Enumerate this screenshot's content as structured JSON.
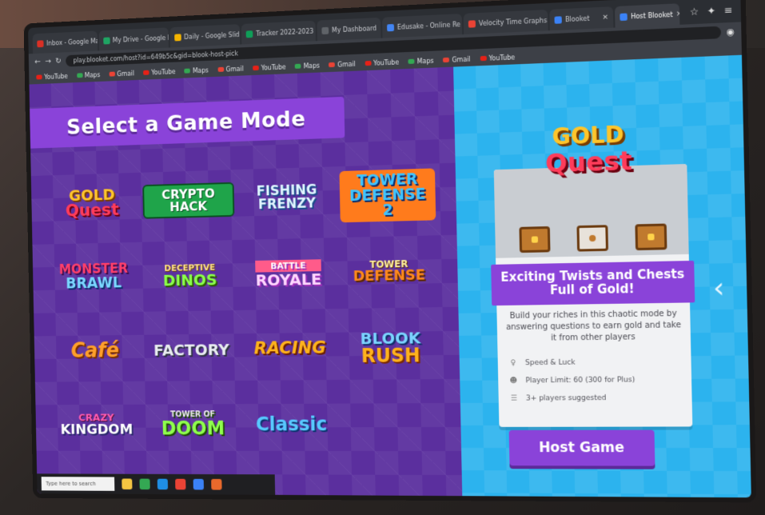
{
  "browser": {
    "tabs": [
      {
        "title": "Inbox - Google Mail",
        "color": "#d93025"
      },
      {
        "title": "My Drive - Google Dr",
        "color": "#1fa463"
      },
      {
        "title": "Daily - Google Slides",
        "color": "#f4b400"
      },
      {
        "title": "Tracker 2022-2023",
        "color": "#0f9d58"
      },
      {
        "title": "My Dashboard",
        "color": "#5f6368"
      },
      {
        "title": "Edusake - Online Re",
        "color": "#4285f4"
      },
      {
        "title": "Velocity Time Graphs",
        "color": "#ea4335"
      },
      {
        "title": "Blooket",
        "color": "#3b82f6"
      },
      {
        "title": "Host Blooket",
        "color": "#3b82f6",
        "active": true
      }
    ],
    "url": "play.blooket.com/host?id=649b5c&gid=blook-host-pick",
    "bookmarks": [
      "YouTube",
      "Maps",
      "Gmail",
      "YouTube",
      "Maps",
      "Gmail",
      "YouTube",
      "Maps",
      "Gmail",
      "YouTube",
      "Maps",
      "Gmail",
      "YouTube"
    ]
  },
  "modes_panel": {
    "title": "Select a Game Mode",
    "modes": [
      {
        "id": "gold",
        "line1": "GOLD",
        "line2": "Quest"
      },
      {
        "id": "crypto",
        "line1": "CRYPTO HACK"
      },
      {
        "id": "fish",
        "line1": "FISHING FRENZY"
      },
      {
        "id": "tower",
        "line1": "TOWER DEFENSE 2"
      },
      {
        "id": "monster",
        "line1": "MONSTER",
        "line2": "BRAWL"
      },
      {
        "id": "dino",
        "line1": "DINOS",
        "line2": "DECEPTIVE"
      },
      {
        "id": "battle",
        "line1": "ROYALE",
        "line2": "BATTLE"
      },
      {
        "id": "td",
        "line1": "DEFENSE",
        "line2": "TOWER"
      },
      {
        "id": "cafe",
        "line1": "Café"
      },
      {
        "id": "factory",
        "line1": "FACTORY"
      },
      {
        "id": "racing",
        "line1": "RACING"
      },
      {
        "id": "blook",
        "line1": "BLOOK",
        "line2": "RUSH"
      },
      {
        "id": "kingdom",
        "line1": "CRAZY",
        "line2": "KINGDOM"
      },
      {
        "id": "doom",
        "line1": "DOOM",
        "line2": "TOWER OF"
      },
      {
        "id": "classic",
        "line1": "Classic"
      }
    ]
  },
  "taskbar": {
    "search_placeholder": "Type here to search"
  },
  "detail_panel": {
    "logo_gold": "GOLD",
    "logo_quest": "Quest",
    "headline": "Exciting Twists and Chests Full of Gold!",
    "description": "Build your riches in this chaotic mode by answering questions to earn gold and take it from other players",
    "stats": [
      {
        "icon": "lightbulb-icon",
        "text": "Speed & Luck"
      },
      {
        "icon": "players-icon",
        "text": "Player Limit: 60 (300 for Plus)"
      },
      {
        "icon": "list-icon",
        "text": "3+ players suggested"
      }
    ],
    "host_button": "Host Game",
    "next_arrow": "‹"
  }
}
